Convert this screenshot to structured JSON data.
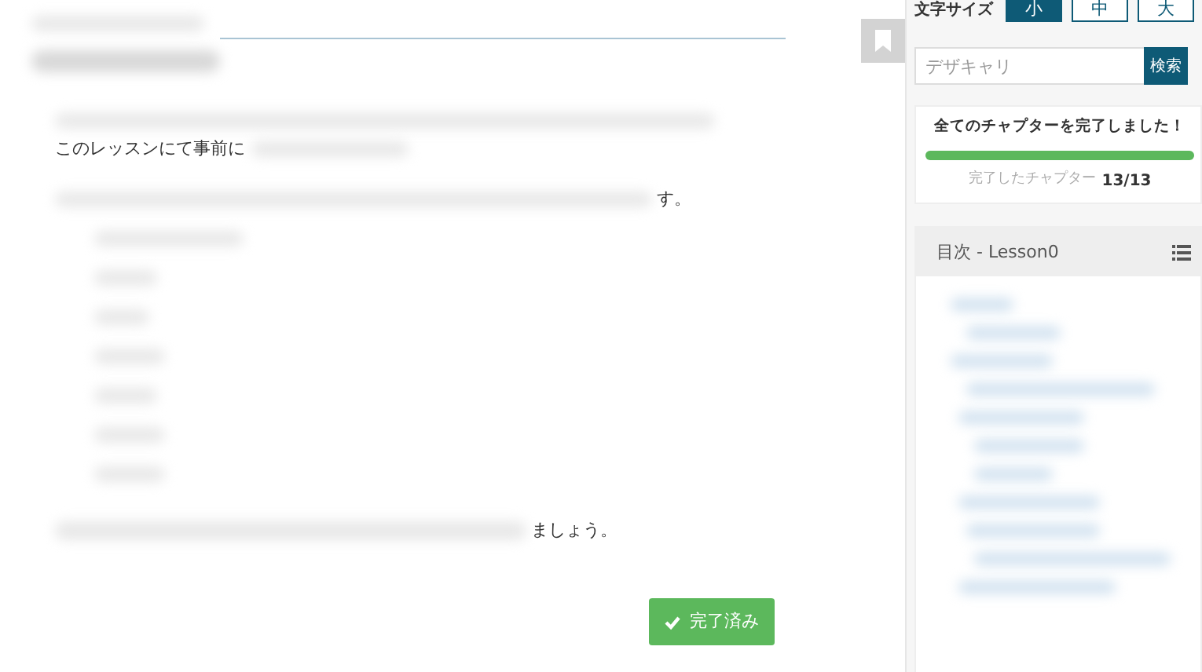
{
  "content": {
    "fragments": [
      {
        "kind": "lead",
        "text": "このレッスンにて事前に"
      },
      {
        "kind": "tail",
        "text": "す。"
      },
      {
        "kind": "tail",
        "text": "ましょう。"
      }
    ],
    "complete_button": {
      "label": "完了済み"
    }
  },
  "sidebar": {
    "font_size": {
      "label": "文字サイズ",
      "options": [
        {
          "label": "小",
          "selected": true
        },
        {
          "label": "中",
          "selected": false
        },
        {
          "label": "大",
          "selected": false
        }
      ]
    },
    "search": {
      "placeholder": "デザキャリ",
      "button": "検索"
    },
    "progress": {
      "title": "全てのチャプターを完了しました！",
      "level": 1,
      "caption": "完了したチャプター",
      "count": "13/13"
    },
    "toc": {
      "title": "目次 - Lesson0"
    }
  }
}
